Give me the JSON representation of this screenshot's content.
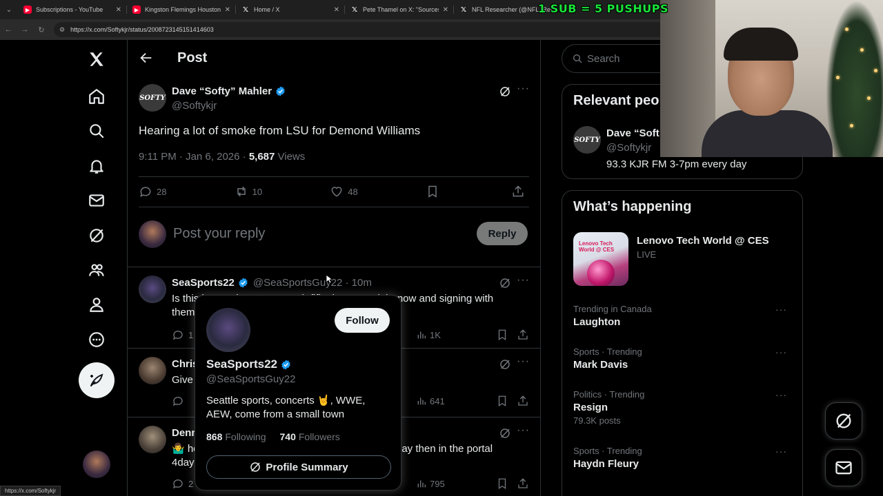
{
  "browser": {
    "tabs": [
      {
        "title": "Subscriptions - YouTube",
        "favicon": "youtube-icon"
      },
      {
        "title": "Kingston Flemings Houston Mi",
        "favicon": "youtube-icon"
      },
      {
        "title": "Home / X",
        "favicon": "x-logo-icon"
      },
      {
        "title": "Pete Thamel on X: \"Sources: Ol",
        "favicon": "x-logo-icon"
      },
      {
        "title": "NFL Researcher (@NFL_Rese",
        "favicon": "x-logo-icon"
      }
    ],
    "url": "https://x.com/Softykjr/status/2008723145151414603",
    "status_url": "https://x.com/Softykjr"
  },
  "overlay": {
    "banner": "1 SUB = 5 PUSHUPS"
  },
  "header": {
    "title": "Post"
  },
  "post": {
    "author_name": "Dave “Softy” Mahler",
    "author_handle": "@Softykjr",
    "avatar_text": "SOFTY",
    "text": "Hearing a lot of smoke from LSU for Demond Williams",
    "time": "9:11 PM · Jan 6, 2026 · ",
    "views_count": "5,687",
    "views_label": " Views",
    "replies": "28",
    "reposts": "10",
    "likes": "48"
  },
  "reply_composer": {
    "placeholder": "Post your reply",
    "button": "Reply"
  },
  "replies": [
    {
      "name": "SeaSports22",
      "handle": "@SeaSportsGuy22 · 10m",
      "text": "Is this happening cause Nash fifita is at UW right now and signing with them? I saw some stuff about it.",
      "reply_count": "1",
      "views": "1K"
    },
    {
      "name": "Chris",
      "handle": "",
      "text": "Give it a week then in the portal then \"in Dawd\"",
      "reply_count": "",
      "views": "641"
    },
    {
      "name": "Denn",
      "handle": "",
      "text": "🤷‍♂️ how does he get a deal with Washington one day then in the portal 4days later",
      "reply_count": "2",
      "views": "795"
    }
  ],
  "hovercard": {
    "name": "SeaSports22",
    "handle": "@SeaSportsGuy22",
    "bio": "Seattle sports, concerts 🤘, WWE, AEW, come from a small town",
    "following_count": "868",
    "following_label": "Following",
    "followers_count": "740",
    "followers_label": "Followers",
    "follow_button": "Follow",
    "summary_button": "Profile Summary"
  },
  "sidebar": {
    "search_placeholder": "Search",
    "relevant_title": "Relevant peo",
    "relevant_person": {
      "name": "Dave “Soft",
      "handle": "@Softykjr",
      "bio": "93.3 KJR FM 3-7pm every day",
      "avatar_text": "SOFTY"
    },
    "happening_title": "What’s happening",
    "event": {
      "title": "Lenovo Tech World @ CES",
      "status": "LIVE",
      "thumb_text": "Lenovo Tech World @ CES"
    },
    "trends": [
      {
        "category": "Trending in Canada",
        "name": "Laughton",
        "count": ""
      },
      {
        "category": "Sports · Trending",
        "name": "Mark Davis",
        "count": ""
      },
      {
        "category": "Politics · Trending",
        "name": "Resign",
        "count": "79.3K posts"
      },
      {
        "category": "Sports · Trending",
        "name": "Haydn Fleury",
        "count": ""
      }
    ]
  },
  "colors": {
    "accent_blue": "#1d9bf0",
    "banner_green": "#19e33a",
    "background": "#000000",
    "border": "#2f3336",
    "text_secondary": "#71767b"
  }
}
